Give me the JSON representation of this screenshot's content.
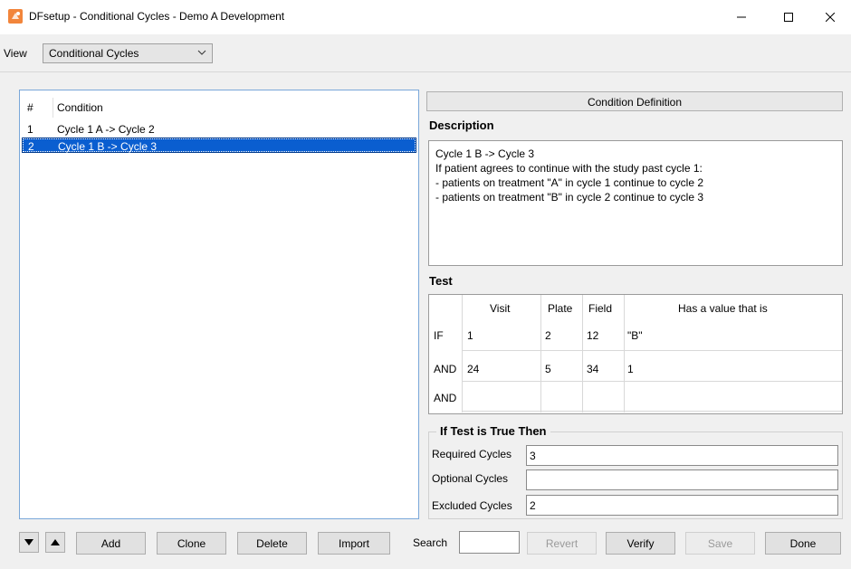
{
  "window": {
    "title": "DFsetup - Conditional Cycles - Demo A Development",
    "icon": "app-logo-icon",
    "controls": [
      "minimize-icon",
      "maximize-icon",
      "close-icon"
    ]
  },
  "view": {
    "label": "View",
    "selected": "Conditional Cycles"
  },
  "conditions": {
    "headers": {
      "num": "#",
      "condition": "Condition"
    },
    "rows": [
      {
        "num": "1",
        "condition": "Cycle 1 A -> Cycle 2"
      },
      {
        "num": "2",
        "condition": "Cycle 1 B -> Cycle 3",
        "selected": true
      }
    ]
  },
  "definition": {
    "header": "Condition Definition",
    "description_label": "Description",
    "description_lines": [
      "Cycle 1 B -> Cycle 3",
      "If patient agrees to continue with the study past cycle 1:",
      "- patients on treatment \"A\" in cycle 1 continue to cycle 2",
      "- patients on treatment \"B\" in cycle 2 continue to cycle 3"
    ],
    "test_label": "Test",
    "test_headers": {
      "visit": "Visit",
      "plate": "Plate",
      "field": "Field",
      "value": "Has a value that is"
    },
    "test_rows": [
      {
        "op": "IF",
        "visit": "1",
        "plate": "2",
        "field": "12",
        "value": "\"B\""
      },
      {
        "op": "AND",
        "visit": "24",
        "plate": "5",
        "field": "34",
        "value": "1"
      },
      {
        "op": "AND",
        "visit": "",
        "plate": "",
        "field": "",
        "value": ""
      }
    ],
    "iftrue_label": "If Test is True Then",
    "required_label": "Required Cycles",
    "required_value": "3",
    "optional_label": "Optional Cycles",
    "optional_value": "",
    "excluded_label": "Excluded Cycles",
    "excluded_value": "2"
  },
  "buttons": {
    "add": "Add",
    "clone": "Clone",
    "delete": "Delete",
    "import": "Import",
    "search_label": "Search",
    "revert": "Revert",
    "verify": "Verify",
    "save": "Save",
    "done": "Done"
  },
  "colors": {
    "selection": "#0a5ed0",
    "accent_border": "#7aa7d9",
    "app_icon": "#f2853b"
  }
}
